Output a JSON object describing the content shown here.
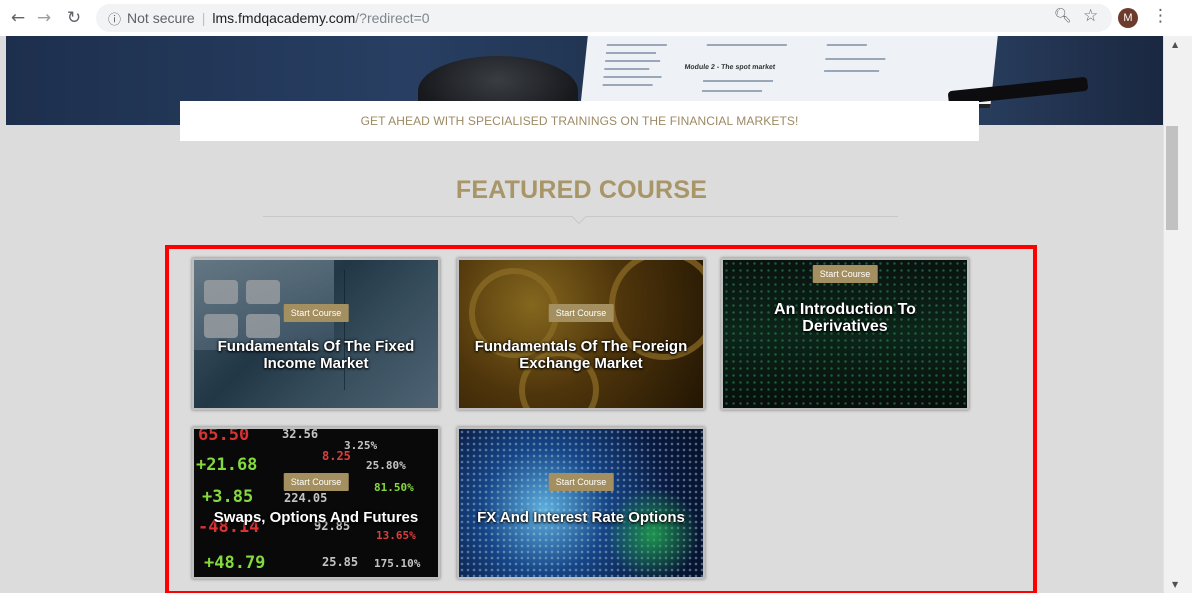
{
  "browser": {
    "security_label": "Not secure",
    "host": "lms.fmdqacademy.com",
    "path": "/?redirect=0",
    "profile_initial": "M"
  },
  "hero": {
    "module_caption": "Module 2 - The spot market"
  },
  "tagline": "GET AHEAD WITH SPECIALISED TRAININGS ON THE FINANCIAL MARKETS!",
  "section_title": "FEATURED COURSE",
  "courses": [
    {
      "badge": "Start Course",
      "title": "Fundamentals Of The Fixed Income Market"
    },
    {
      "badge": "Start Course",
      "title": "Fundamentals Of The Foreign Exchange Market"
    },
    {
      "badge": "Start Course",
      "title": "An Introduction To Derivatives"
    },
    {
      "badge": "Start Course",
      "title": "Swaps, Options And Futures"
    },
    {
      "badge": "Start Course",
      "title": "FX And Interest Rate Options"
    }
  ],
  "ticker_values": [
    "65.50",
    "32.56",
    "3.25%",
    "+21.68",
    "8.25",
    "25.80%",
    "+3.85",
    "224.05",
    "81.50%",
    "-48.14",
    "92.85",
    "13.65%",
    "+48.79",
    "25.85",
    "175.10%"
  ],
  "colors": {
    "accent": "#a89568",
    "badge": "#a38f5f",
    "highlight": "#ff0000"
  },
  "icons": {
    "back": "arrow-left-icon",
    "forward": "arrow-right-icon",
    "reload": "reload-icon",
    "info": "info-icon",
    "zoom": "zoom-icon",
    "bookmark": "star-icon",
    "menu": "kebab-menu-icon"
  }
}
